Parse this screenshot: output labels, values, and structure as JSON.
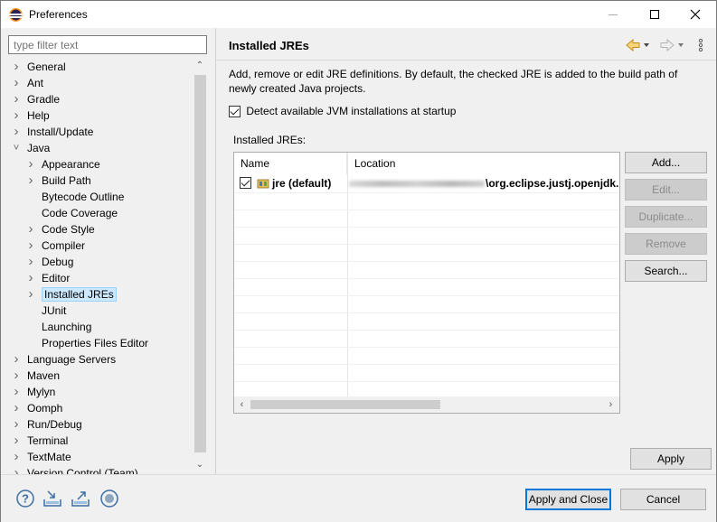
{
  "window": {
    "title": "Preferences"
  },
  "filter": {
    "placeholder": "type filter text"
  },
  "tree": [
    {
      "label": "General",
      "depth": 0,
      "expander": "collapsed"
    },
    {
      "label": "Ant",
      "depth": 0,
      "expander": "collapsed"
    },
    {
      "label": "Gradle",
      "depth": 0,
      "expander": "collapsed"
    },
    {
      "label": "Help",
      "depth": 0,
      "expander": "collapsed"
    },
    {
      "label": "Install/Update",
      "depth": 0,
      "expander": "collapsed"
    },
    {
      "label": "Java",
      "depth": 0,
      "expander": "expanded"
    },
    {
      "label": "Appearance",
      "depth": 1,
      "expander": "collapsed"
    },
    {
      "label": "Build Path",
      "depth": 1,
      "expander": "collapsed"
    },
    {
      "label": "Bytecode Outline",
      "depth": 1,
      "expander": "none"
    },
    {
      "label": "Code Coverage",
      "depth": 1,
      "expander": "none"
    },
    {
      "label": "Code Style",
      "depth": 1,
      "expander": "collapsed"
    },
    {
      "label": "Compiler",
      "depth": 1,
      "expander": "collapsed"
    },
    {
      "label": "Debug",
      "depth": 1,
      "expander": "collapsed"
    },
    {
      "label": "Editor",
      "depth": 1,
      "expander": "collapsed"
    },
    {
      "label": "Installed JREs",
      "depth": 1,
      "expander": "collapsed",
      "selected": true
    },
    {
      "label": "JUnit",
      "depth": 1,
      "expander": "none"
    },
    {
      "label": "Launching",
      "depth": 1,
      "expander": "none"
    },
    {
      "label": "Properties Files Editor",
      "depth": 1,
      "expander": "none"
    },
    {
      "label": "Language Servers",
      "depth": 0,
      "expander": "collapsed"
    },
    {
      "label": "Maven",
      "depth": 0,
      "expander": "collapsed"
    },
    {
      "label": "Mylyn",
      "depth": 0,
      "expander": "collapsed"
    },
    {
      "label": "Oomph",
      "depth": 0,
      "expander": "collapsed"
    },
    {
      "label": "Run/Debug",
      "depth": 0,
      "expander": "collapsed"
    },
    {
      "label": "Terminal",
      "depth": 0,
      "expander": "collapsed"
    },
    {
      "label": "TextMate",
      "depth": 0,
      "expander": "collapsed"
    },
    {
      "label": "Version Control (Team)",
      "depth": 0,
      "expander": "collapsed"
    }
  ],
  "page": {
    "title": "Installed JREs",
    "description": "Add, remove or edit JRE definitions. By default, the checked JRE is added to the build path of newly created Java projects.",
    "detect_label": "Detect available JVM installations at startup",
    "detect_checked": true,
    "installed_label": "Installed JREs:",
    "table": {
      "columns": [
        "Name",
        "Location"
      ],
      "rows": [
        {
          "checked": true,
          "name": "jre (default)",
          "location": "\\org.eclipse.justj.openjdk.h"
        }
      ]
    },
    "buttons": {
      "add": "Add...",
      "edit": "Edit...",
      "duplicate": "Duplicate...",
      "remove": "Remove",
      "search": "Search..."
    },
    "apply": "Apply"
  },
  "footer": {
    "apply_close": "Apply and Close",
    "cancel": "Cancel"
  },
  "colors": {
    "selection": "#cce8ff",
    "accent": "#0078d7",
    "icon": "#3b6ea5"
  }
}
